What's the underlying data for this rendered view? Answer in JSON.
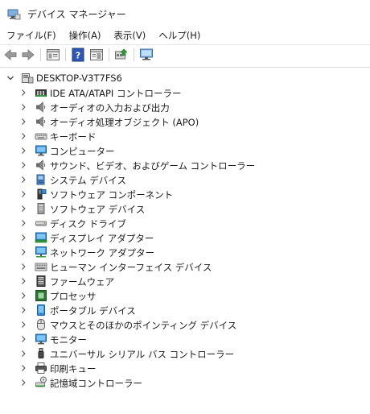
{
  "window": {
    "title": "デバイス マネージャー"
  },
  "menu": [
    {
      "label": "ファイル(F)"
    },
    {
      "label": "操作(A)"
    },
    {
      "label": "表示(V)"
    },
    {
      "label": "ヘルプ(H)"
    }
  ],
  "toolbar": {
    "buttons": [
      "back-arrow-icon",
      "forward-arrow-icon",
      "properties-icon",
      "help-icon",
      "details-pane-icon",
      "update-driver-icon",
      "scan-hardware-icon"
    ]
  },
  "tree": {
    "root": {
      "label": "DESKTOP-V3T7FS6",
      "icon": "computer-root-icon"
    },
    "nodes": [
      {
        "label": "IDE ATA/ATAPI コントローラー",
        "icon": "ide-controller-icon"
      },
      {
        "label": "オーディオの入力および出力",
        "icon": "speaker-icon"
      },
      {
        "label": "オーディオ処理オブジェクト (APO)",
        "icon": "speaker-icon"
      },
      {
        "label": "キーボード",
        "icon": "keyboard-icon"
      },
      {
        "label": "コンピューター",
        "icon": "monitor-icon"
      },
      {
        "label": "サウンド、ビデオ、およびゲーム コントローラー",
        "icon": "speaker-icon"
      },
      {
        "label": "システム デバイス",
        "icon": "system-device-icon"
      },
      {
        "label": "ソフトウェア コンポーネント",
        "icon": "software-component-icon"
      },
      {
        "label": "ソフトウェア デバイス",
        "icon": "software-device-icon"
      },
      {
        "label": "ディスク ドライブ",
        "icon": "disk-drive-icon"
      },
      {
        "label": "ディスプレイ アダプター",
        "icon": "display-adapter-icon"
      },
      {
        "label": "ネットワーク アダプター",
        "icon": "network-adapter-icon"
      },
      {
        "label": "ヒューマン インターフェイス デバイス",
        "icon": "hid-icon"
      },
      {
        "label": "ファームウェア",
        "icon": "firmware-icon"
      },
      {
        "label": "プロセッサ",
        "icon": "processor-icon"
      },
      {
        "label": "ポータブル デバイス",
        "icon": "portable-device-icon"
      },
      {
        "label": "マウスとそのほかのポインティング デバイス",
        "icon": "mouse-icon"
      },
      {
        "label": "モニター",
        "icon": "monitor-icon"
      },
      {
        "label": "ユニバーサル シリアル バス コントローラー",
        "icon": "usb-icon"
      },
      {
        "label": "印刷キュー",
        "icon": "printer-icon"
      },
      {
        "label": "記憶域コントローラー",
        "icon": "storage-controller-icon"
      }
    ]
  }
}
